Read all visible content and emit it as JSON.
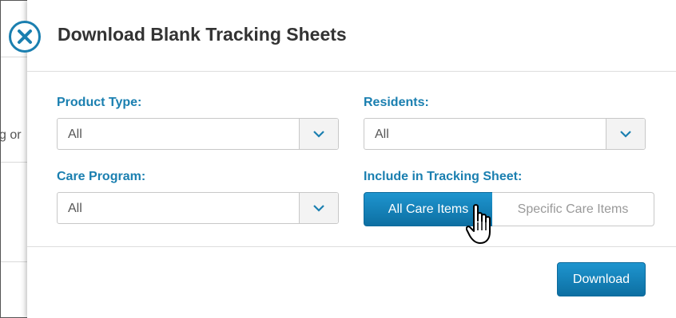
{
  "background": {
    "partial_text": "g or"
  },
  "modal": {
    "title": "Download Blank Tracking Sheets",
    "close_icon": "close-circle-icon",
    "accent_color": "#1a7fb0"
  },
  "fields": {
    "product_type": {
      "label": "Product Type:",
      "value": "All"
    },
    "residents": {
      "label": "Residents:",
      "value": "All"
    },
    "care_program": {
      "label": "Care Program:",
      "value": "All"
    },
    "include": {
      "label": "Include in Tracking Sheet:",
      "options": [
        "All Care Items",
        "Specific Care Items"
      ],
      "selected": "All Care Items"
    }
  },
  "footer": {
    "download_label": "Download"
  },
  "cursor_icon": "hand-pointer-icon"
}
